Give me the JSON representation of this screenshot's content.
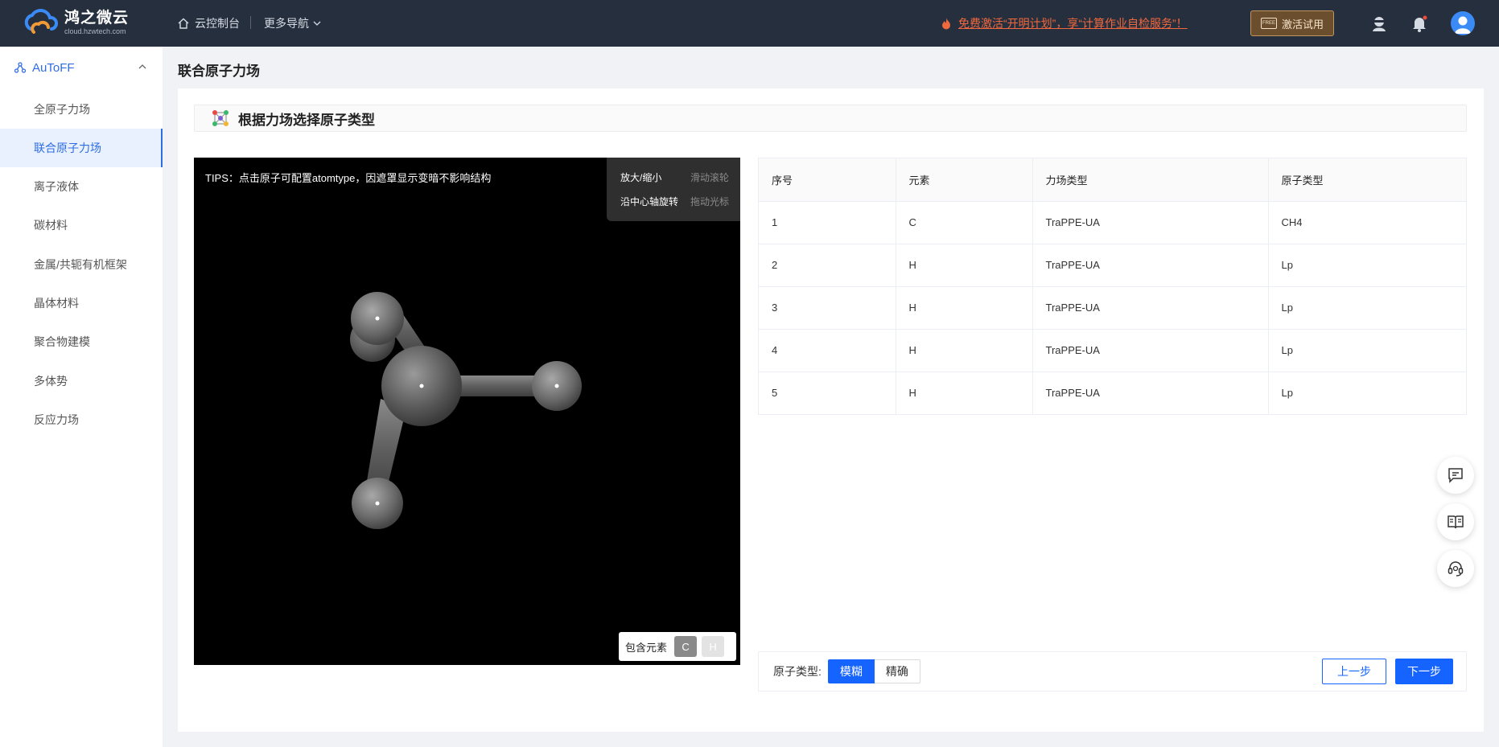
{
  "header": {
    "logo_name": "鸿之微云",
    "logo_url": "cloud.hzwtech.com",
    "console_label": "云控制台",
    "more_nav_label": "更多导航",
    "promo_text": "免费激活“开明计划”，享“计算作业自检服务”！",
    "trial_label": "激活试用",
    "trial_badge": "FREE"
  },
  "sidebar": {
    "group_label": "AuToFF",
    "items": [
      {
        "label": "全原子力场"
      },
      {
        "label": "联合原子力场"
      },
      {
        "label": "离子液体"
      },
      {
        "label": "碳材料"
      },
      {
        "label": "金属/共轭有机框架"
      },
      {
        "label": "晶体材料"
      },
      {
        "label": "聚合物建模"
      },
      {
        "label": "多体势"
      },
      {
        "label": "反应力场"
      }
    ]
  },
  "page": {
    "title": "联合原子力场",
    "section_title": "根据力场选择原子类型"
  },
  "viewer": {
    "tips": "TIPS：点击原子可配置atomtype，因遮罩显示变暗不影响结构",
    "zoom_label": "放大/缩小",
    "zoom_hint": "滑动滚轮",
    "rotate_label": "沿中心轴旋转",
    "rotate_hint": "拖动光标",
    "elements_label": "包含元素",
    "elements": [
      "C",
      "H"
    ]
  },
  "table": {
    "headers": [
      "序号",
      "元素",
      "力场类型",
      "原子类型"
    ],
    "rows": [
      [
        "1",
        "C",
        "TraPPE-UA",
        "CH4"
      ],
      [
        "2",
        "H",
        "TraPPE-UA",
        "Lp"
      ],
      [
        "3",
        "H",
        "TraPPE-UA",
        "Lp"
      ],
      [
        "4",
        "H",
        "TraPPE-UA",
        "Lp"
      ],
      [
        "5",
        "H",
        "TraPPE-UA",
        "Lp"
      ]
    ]
  },
  "footer": {
    "atom_type_label": "原子类型:",
    "mode_fuzzy": "模糊",
    "mode_exact": "精确",
    "prev_label": "上一步",
    "next_label": "下一步"
  },
  "colors": {
    "primary": "#1664ff",
    "sidebar_active": "#2f6de5",
    "topbar": "#262f3e",
    "promo": "#f0683d"
  },
  "icons": [
    "home-icon",
    "chevron-down-icon",
    "fire-icon",
    "support-agent-icon",
    "bell-icon",
    "user-avatar-icon",
    "network-icon",
    "chevron-up-icon",
    "molecule-icon",
    "chat-icon",
    "book-icon",
    "headset-icon"
  ]
}
